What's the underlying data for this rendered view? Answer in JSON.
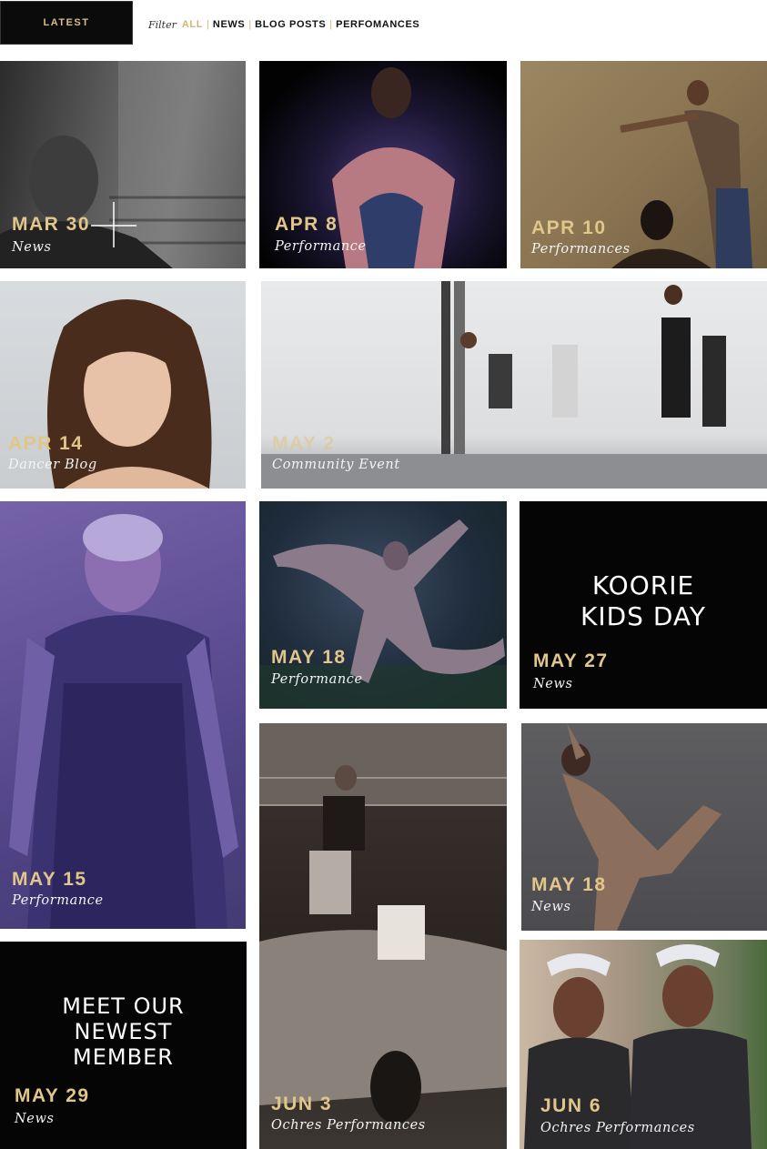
{
  "header": {
    "latest_label": "LATEST",
    "filter_label": "Filter",
    "filters": [
      "ALL",
      "NEWS",
      "BLOG POSTS",
      "PERFOMANCES"
    ],
    "active_filter": "ALL"
  },
  "colors": {
    "accent": "#d4b47a",
    "date_gold": "#e1c689",
    "tile_black": "#050505"
  },
  "tiles": [
    {
      "date": "MAR 30",
      "category": "News"
    },
    {
      "date": "APR 8",
      "category": "Performance"
    },
    {
      "date": "APR 10",
      "category": "Performances"
    },
    {
      "date": "APR 14",
      "category": "Dancer Blog"
    },
    {
      "date": "MAY 2",
      "category": "Community Event"
    },
    {
      "date": "MAY 15",
      "category": "Performance"
    },
    {
      "date": "MAY 18",
      "category": "Performance"
    },
    {
      "date": "MAY 27",
      "category": "News",
      "headline_lines": [
        "KOORIE",
        "KIDS DAY"
      ]
    },
    {
      "date": "MAY 18",
      "category": "News"
    },
    {
      "date": "JUN 3",
      "category": "Ochres Performances"
    },
    {
      "date": "MAY 29",
      "category": "News",
      "headline_lines": [
        "MEET OUR",
        "NEWEST",
        "MEMBER"
      ]
    },
    {
      "date": "JUN 6",
      "category": "Ochres Performances"
    }
  ]
}
